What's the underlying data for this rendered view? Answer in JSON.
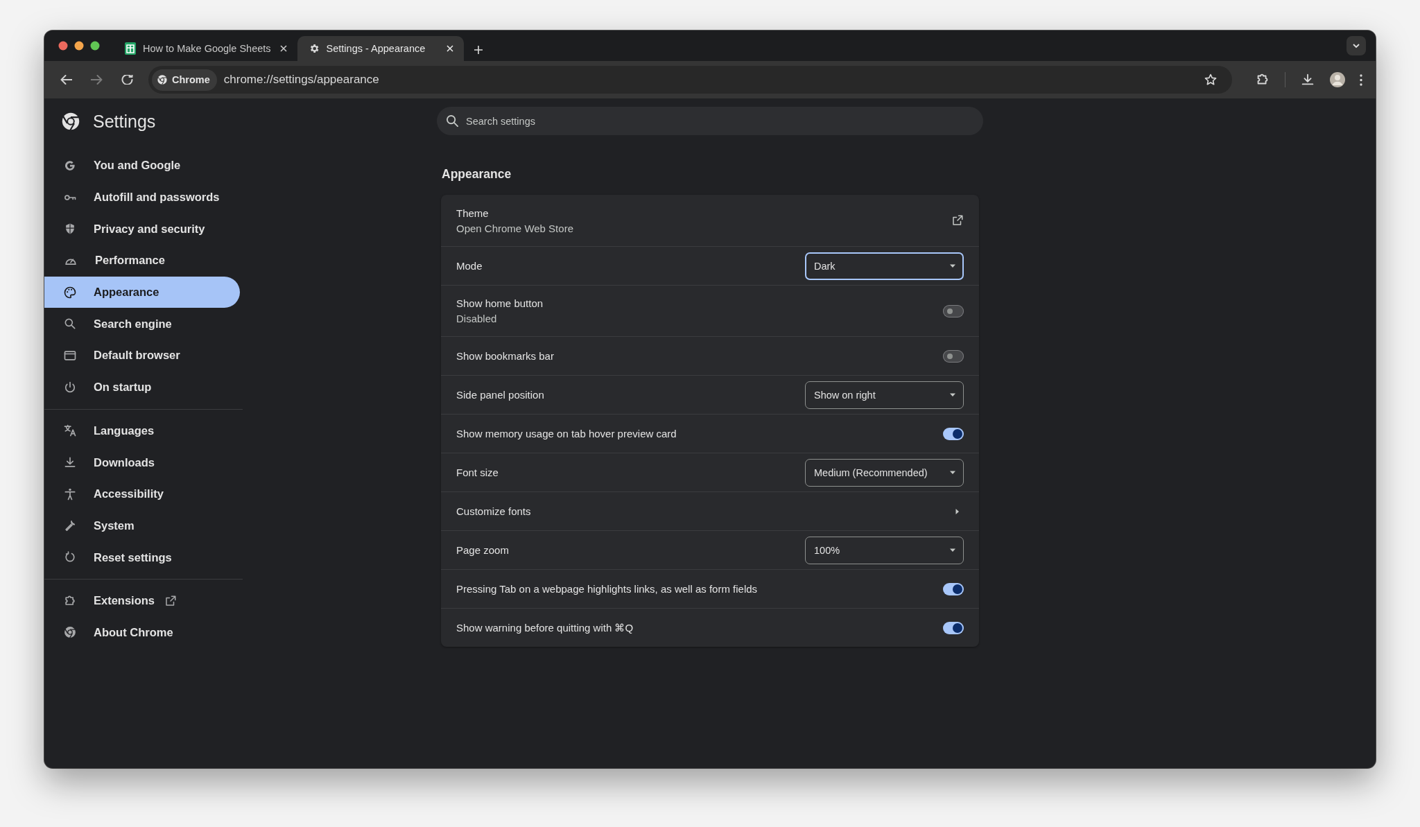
{
  "browser": {
    "tabs": [
      {
        "title": "How to Make Google Sheets",
        "selected": false
      },
      {
        "title": "Settings - Appearance",
        "selected": true
      }
    ],
    "nav_buttons": [
      {
        "kind": "back",
        "disabled": false
      },
      {
        "kind": "forward",
        "disabled": true
      },
      {
        "kind": "reload",
        "disabled": false
      }
    ],
    "address": {
      "chip": "Chrome",
      "url": "chrome://settings/appearance"
    }
  },
  "sidebar": {
    "title": "Settings",
    "groups": [
      {
        "items": [
          {
            "label": "You and Google",
            "kind": "page",
            "selected": false
          },
          {
            "label": "Autofill and passwords",
            "kind": "page",
            "selected": false
          },
          {
            "label": "Privacy and security",
            "kind": "page",
            "selected": false
          },
          {
            "label": "Performance",
            "kind": "page",
            "selected": false
          },
          {
            "label": "Appearance",
            "kind": "page",
            "selected": true
          },
          {
            "label": "Search engine",
            "kind": "page",
            "selected": false
          },
          {
            "label": "Default browser",
            "kind": "page",
            "selected": false
          },
          {
            "label": "On startup",
            "kind": "page",
            "selected": false
          }
        ]
      },
      {
        "items": [
          {
            "label": "Languages",
            "kind": "page",
            "selected": false
          },
          {
            "label": "Downloads",
            "kind": "page",
            "selected": false
          },
          {
            "label": "Accessibility",
            "kind": "page",
            "selected": false
          },
          {
            "label": "System",
            "kind": "page",
            "selected": false
          },
          {
            "label": "Reset settings",
            "kind": "page",
            "selected": false
          }
        ]
      },
      {
        "items": [
          {
            "label": "Extensions",
            "kind": "external",
            "selected": false
          },
          {
            "label": "About Chrome",
            "kind": "page",
            "selected": false
          }
        ]
      }
    ]
  },
  "main": {
    "search": {
      "placeholder": "Search settings"
    },
    "section_title": "Appearance",
    "rows": [
      {
        "kind": "link",
        "label": "Theme",
        "sublabel": "Open Chrome Web Store"
      },
      {
        "kind": "select",
        "label": "Mode",
        "value": "Dark",
        "focused": true
      },
      {
        "kind": "toggle",
        "label": "Show home button",
        "sublabel": "Disabled",
        "on": false
      },
      {
        "kind": "toggle",
        "label": "Show bookmarks bar",
        "on": false
      },
      {
        "kind": "select",
        "label": "Side panel position",
        "value": "Show on right",
        "focused": false
      },
      {
        "kind": "toggle",
        "label": "Show memory usage on tab hover preview card",
        "on": true
      },
      {
        "kind": "select",
        "label": "Font size",
        "value": "Medium (Recommended)",
        "focused": false
      },
      {
        "kind": "subpage",
        "label": "Customize fonts"
      },
      {
        "kind": "select",
        "label": "Page zoom",
        "value": "100%",
        "focused": false
      },
      {
        "kind": "toggle",
        "label": "Pressing Tab on a webpage highlights links, as well as form fields",
        "on": true
      },
      {
        "kind": "toggle",
        "label": "Show warning before quitting with ⌘Q",
        "on": true
      }
    ]
  }
}
